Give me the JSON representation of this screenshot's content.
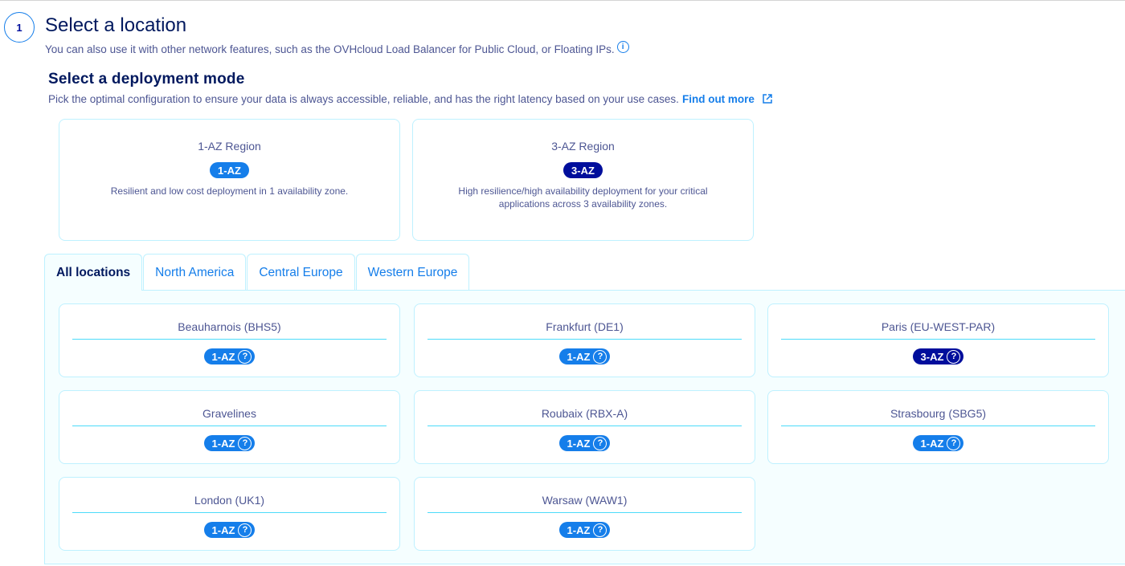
{
  "step": {
    "number": "1",
    "title": "Select a location",
    "subtitle": "You can also use it with other network features, such as the OVHcloud Load Balancer for Public Cloud, or Floating IPs.",
    "info_icon": "info-icon"
  },
  "deployment": {
    "title": "Select a deployment mode",
    "description": "Pick the optimal configuration to ensure your data is always accessible, reliable, and has the right latency based on your use cases.",
    "link_label": "Find out more",
    "link_icon": "external-link-icon",
    "modes": [
      {
        "title": "1-AZ Region",
        "badge": "1-AZ",
        "description": "Resilient and low cost deployment in 1 availability zone."
      },
      {
        "title": "3-AZ Region",
        "badge": "3-AZ",
        "description": "High resilience/high availability deployment for your critical applications across 3 availability zones."
      }
    ]
  },
  "tabs": [
    {
      "label": "All locations",
      "active": true
    },
    {
      "label": "North America",
      "active": false
    },
    {
      "label": "Central Europe",
      "active": false
    },
    {
      "label": "Western Europe",
      "active": false
    }
  ],
  "locations": [
    {
      "name": "Beauharnois (BHS5)",
      "badge": "1-AZ"
    },
    {
      "name": "Frankfurt (DE1)",
      "badge": "1-AZ"
    },
    {
      "name": "Paris (EU-WEST-PAR)",
      "badge": "3-AZ"
    },
    {
      "name": "Gravelines",
      "badge": "1-AZ"
    },
    {
      "name": "Roubaix (RBX-A)",
      "badge": "1-AZ"
    },
    {
      "name": "Strasbourg (SBG5)",
      "badge": "1-AZ"
    },
    {
      "name": "London (UK1)",
      "badge": "1-AZ"
    },
    {
      "name": "Warsaw (WAW1)",
      "badge": "1-AZ"
    }
  ],
  "help_glyph": "?",
  "colors": {
    "primary": "#157eea",
    "dark": "#000e9c",
    "heading": "#00185e",
    "text": "#4d5693",
    "border": "#bef1ff",
    "panel": "#f5feff"
  }
}
